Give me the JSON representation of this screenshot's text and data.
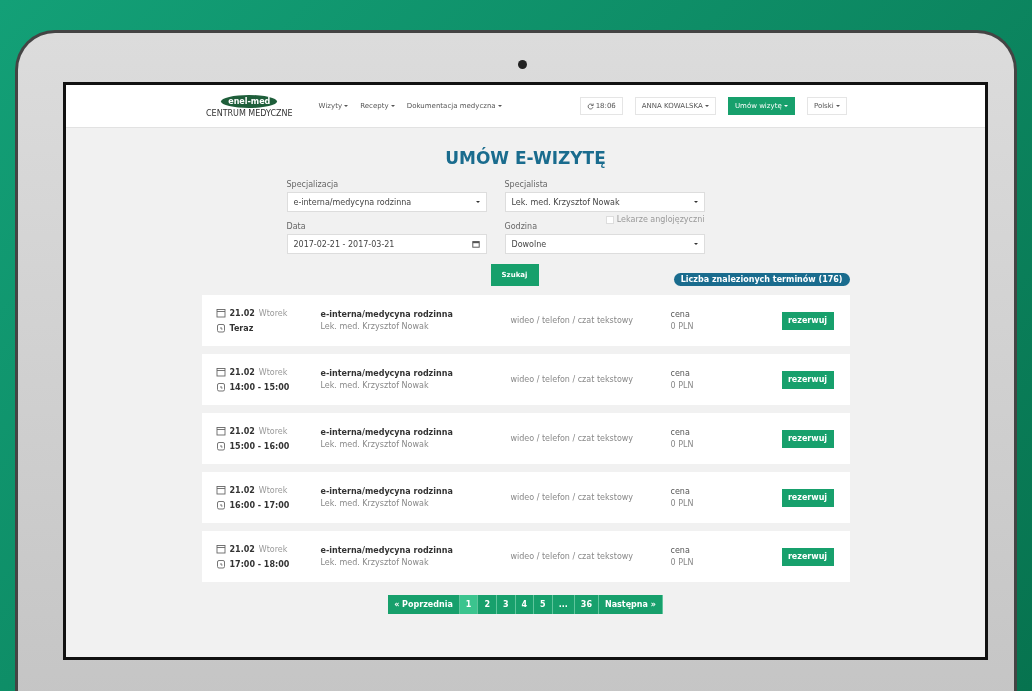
{
  "nav": {
    "logo": {
      "name": "enel-med",
      "subtitle": "CENTRUM MEDYCZNE"
    },
    "menus": [
      "Wizyty",
      "Recepty",
      "Dokumentacja medyczna"
    ],
    "time": "18:06",
    "user": "ANNA KOWALSKA",
    "book_button": "Umów wizytę",
    "language": "Polski"
  },
  "title": "UMÓW E-WIZYTĘ",
  "form": {
    "fields": [
      {
        "label": "Specjalizacja",
        "value": "e-interna/medycyna rodzinna",
        "kind": "select"
      },
      {
        "label": "Specjalista",
        "value": "Lek. med. Krzysztof Nowak",
        "kind": "select"
      },
      {
        "label": "Data",
        "value": "2017-02-21 - 2017-03-21",
        "kind": "date"
      },
      {
        "label": "Godzina",
        "value": "Dowolne",
        "kind": "select"
      }
    ],
    "checkbox": {
      "label": "Lekarze anglojęzyczni",
      "checked": false
    },
    "search_button": "Szukaj"
  },
  "results_count": "Liczba znalezionych terminów (176)",
  "rows": [
    {
      "date": "21.02",
      "weekday": "Wtorek",
      "time": "Teraz",
      "specialty": "e-interna/medycyna rodzinna",
      "doctor": "Lek. med. Krzysztof Nowak",
      "channels": "wideo / telefon / czat tekstowy",
      "price_label": "cena",
      "price": "0 PLN",
      "button": "rezerwuj"
    },
    {
      "date": "21.02",
      "weekday": "Wtorek",
      "time": "14:00 - 15:00",
      "specialty": "e-interna/medycyna rodzinna",
      "doctor": "Lek. med. Krzysztof Nowak",
      "channels": "wideo / telefon / czat tekstowy",
      "price_label": "cena",
      "price": "0 PLN",
      "button": "rezerwuj"
    },
    {
      "date": "21.02",
      "weekday": "Wtorek",
      "time": "15:00 - 16:00",
      "specialty": "e-interna/medycyna rodzinna",
      "doctor": "Lek. med. Krzysztof Nowak",
      "channels": "wideo / telefon / czat tekstowy",
      "price_label": "cena",
      "price": "0 PLN",
      "button": "rezerwuj"
    },
    {
      "date": "21.02",
      "weekday": "Wtorek",
      "time": "16:00 - 17:00",
      "specialty": "e-interna/medycyna rodzinna",
      "doctor": "Lek. med. Krzysztof Nowak",
      "channels": "wideo / telefon / czat tekstowy",
      "price_label": "cena",
      "price": "0 PLN",
      "button": "rezerwuj"
    },
    {
      "date": "21.02",
      "weekday": "Wtorek",
      "time": "17:00 - 18:00",
      "specialty": "e-interna/medycyna rodzinna",
      "doctor": "Lek. med. Krzysztof Nowak",
      "channels": "wideo / telefon / czat tekstowy",
      "price_label": "cena",
      "price": "0 PLN",
      "button": "rezerwuj"
    }
  ],
  "pagination": [
    {
      "label": "« Poprzednia",
      "selected": false
    },
    {
      "label": "1",
      "selected": true
    },
    {
      "label": "2",
      "selected": false
    },
    {
      "label": "3",
      "selected": false
    },
    {
      "label": "4",
      "selected": false
    },
    {
      "label": "5",
      "selected": false
    },
    {
      "label": "...",
      "selected": false
    },
    {
      "label": "36",
      "selected": false
    },
    {
      "label": "Następna »",
      "selected": false
    }
  ]
}
